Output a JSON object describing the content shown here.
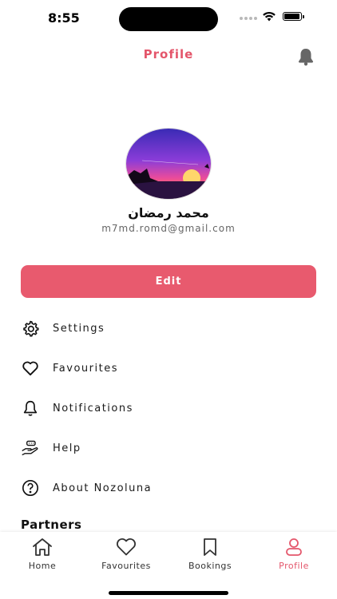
{
  "status_bar": {
    "time": "8:55"
  },
  "header": {
    "title": "Profile",
    "bell_icon": "bell-icon"
  },
  "profile": {
    "name": "محمد رمضان",
    "email": "m7md.romd@gmail.com",
    "avatar_icon": "sunset-avatar-image"
  },
  "actions": {
    "edit_label": "Edit"
  },
  "menu": {
    "items": [
      {
        "label": "Settings",
        "icon": "gear-icon"
      },
      {
        "label": "Favourites",
        "icon": "heart-icon"
      },
      {
        "label": "Notifications",
        "icon": "bell-icon"
      },
      {
        "label": "Help",
        "icon": "hand-help-icon"
      },
      {
        "label": "About Nozoluna",
        "icon": "question-circle-icon"
      }
    ]
  },
  "partners": {
    "heading": "Partners"
  },
  "tabs": [
    {
      "label": "Home",
      "icon": "home-icon",
      "active": false
    },
    {
      "label": "Favourites",
      "icon": "heart-icon",
      "active": false
    },
    {
      "label": "Bookings",
      "icon": "bookmark-icon",
      "active": false
    },
    {
      "label": "Profile",
      "icon": "person-icon",
      "active": true
    }
  ],
  "colors": {
    "accent": "#e4566b",
    "button": "#e85a6e"
  }
}
